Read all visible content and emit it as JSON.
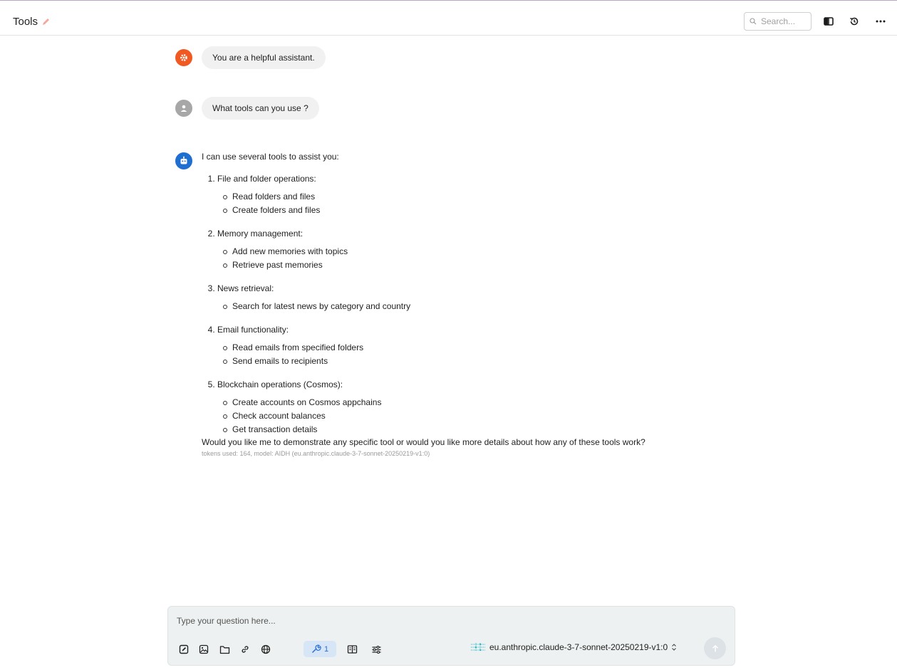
{
  "header": {
    "title": "Tools",
    "search_placeholder": "Search..."
  },
  "messages": {
    "system": {
      "text": "You are a helpful assistant.",
      "avatar_color": "#f05a22"
    },
    "user": {
      "text": "What tools can you use ?",
      "avatar_color": "#a7a7a7"
    },
    "assistant": {
      "avatar_color": "#1f6fd1",
      "intro": "I can use several tools to assist you:",
      "sections": [
        {
          "title": "File and folder operations:",
          "items": [
            "Read folders and files",
            "Create folders and files"
          ]
        },
        {
          "title": "Memory management:",
          "items": [
            "Add new memories with topics",
            "Retrieve past memories"
          ]
        },
        {
          "title": "News retrieval:",
          "items": [
            "Search for latest news by category and country"
          ]
        },
        {
          "title": "Email functionality:",
          "items": [
            "Read emails from specified folders",
            "Send emails to recipients"
          ]
        },
        {
          "title": "Blockchain operations (Cosmos):",
          "items": [
            "Create accounts on Cosmos appchains",
            "Check account balances",
            "Get transaction details"
          ]
        }
      ],
      "closing": "Would you like me to demonstrate any specific tool or would you like more details about how any of these tools work?",
      "meta": "tokens used: 164, model: AIDH (eu.anthropic.claude-3-7-sonnet-20250219-v1:0)"
    }
  },
  "composer": {
    "placeholder": "Type your question here...",
    "tools_count": "1",
    "model": "eu.anthropic.claude-3-7-sonnet-20250219-v1:0",
    "accent": "#2a6fd6"
  }
}
